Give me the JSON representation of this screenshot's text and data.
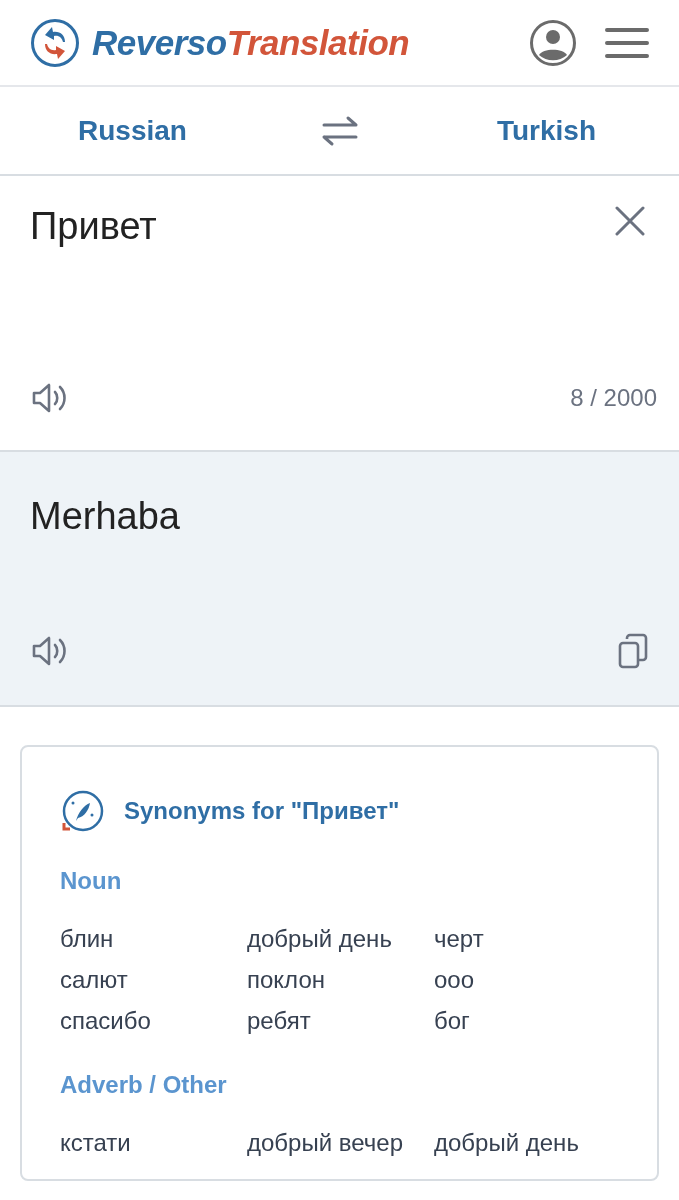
{
  "header": {
    "logo_primary": "Reverso",
    "logo_secondary": "Translation"
  },
  "languages": {
    "source": "Russian",
    "target": "Turkish"
  },
  "input": {
    "value": "Привет",
    "counter": "8 / 2000"
  },
  "output": {
    "text": "Merhaba"
  },
  "synonyms": {
    "title": "Synonyms for \"Привет\"",
    "groups": [
      {
        "label": "Noun",
        "words": [
          "блин",
          "добрый день",
          "черт",
          "салют",
          "поклон",
          "ооо",
          "спасибо",
          "ребят",
          "бог"
        ]
      },
      {
        "label": "Adverb / Other",
        "words": [
          "кстати",
          "добрый вечер",
          "добрый день"
        ]
      }
    ]
  }
}
